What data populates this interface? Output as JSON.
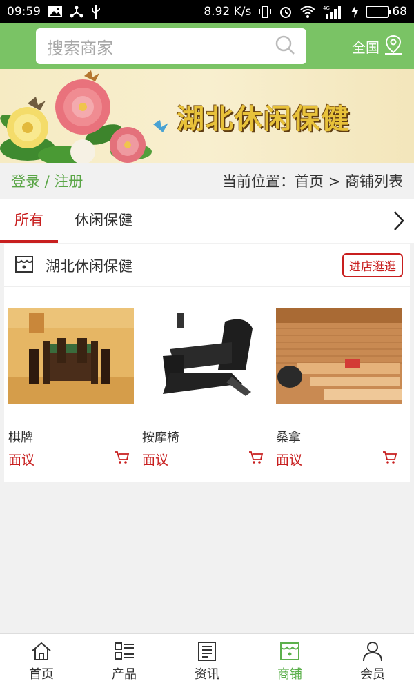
{
  "status_bar": {
    "time": "09:59",
    "speed": "8.92 K/s",
    "network": "4G",
    "battery": "68",
    "battery_level": 0.68,
    "battery_color": "#3fd53f"
  },
  "header": {
    "search_placeholder": "搜索商家",
    "region_label": "全国",
    "bg_color": "#7ac365"
  },
  "banner": {
    "title": "湖北休闲保健"
  },
  "crumb": {
    "login_label": "登录 / 注册",
    "location": "当前位置：首页 > 商铺列表"
  },
  "tabs": [
    {
      "label": "所有",
      "active": true
    },
    {
      "label": "休闲保健",
      "active": false
    }
  ],
  "store": {
    "name": "湖北休闲保健",
    "enter_label": "进店逛逛",
    "products": [
      {
        "name": "棋牌",
        "price": "面议",
        "image": "mahjong-room"
      },
      {
        "name": "按摩椅",
        "price": "面议",
        "image": "massage-chair"
      },
      {
        "name": "桑拿",
        "price": "面议",
        "image": "sauna-room"
      }
    ]
  },
  "bottom_nav": [
    {
      "label": "首页",
      "icon": "home-icon",
      "active": false
    },
    {
      "label": "产品",
      "icon": "grid-list-icon",
      "active": false
    },
    {
      "label": "资讯",
      "icon": "news-icon",
      "active": false
    },
    {
      "label": "商铺",
      "icon": "shop-icon",
      "active": true
    },
    {
      "label": "会员",
      "icon": "user-icon",
      "active": false
    }
  ],
  "colors": {
    "accent_red": "#c81f1f",
    "accent_green": "#5cb04c"
  }
}
